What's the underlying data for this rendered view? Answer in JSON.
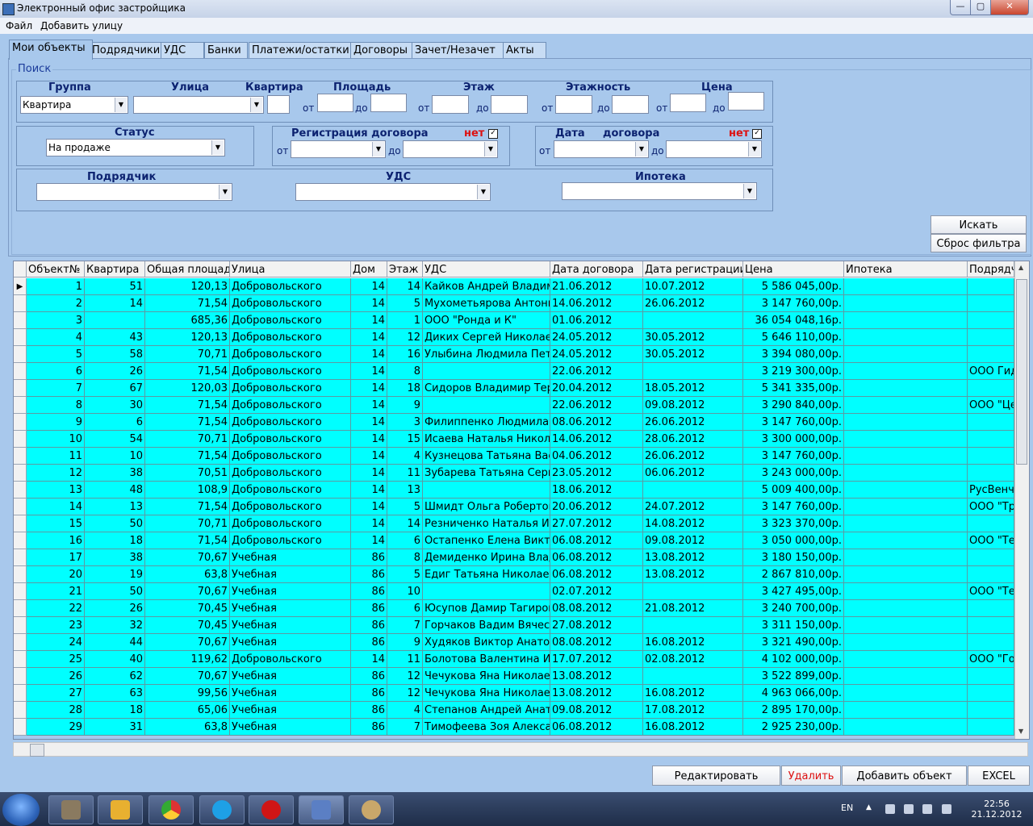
{
  "window": {
    "title": "Электронный офис застройщика",
    "min": "—",
    "max": "▢",
    "close": "✕"
  },
  "menu": [
    "Файл",
    "Добавить улицу"
  ],
  "tabs": [
    "Мои объекты",
    "Подрядчики",
    "УДС",
    "Банки",
    "Платежи/остатки",
    "Договоры",
    "Зачет/Незачет",
    "Акты"
  ],
  "search": {
    "legend": "Поиск",
    "group_label": "Группа",
    "group_value": "Квартира",
    "street_label": "Улица",
    "apartment_label": "Квартира",
    "area_label": "Площадь",
    "floor_label": "Этаж",
    "floors_label": "Этажность",
    "price_label": "Цена",
    "from": "от",
    "to": "до",
    "status_label": "Статус",
    "status_value": "На продаже",
    "reg_label": "Регистрация договора",
    "reg_none": "нет",
    "date_label": "Дата",
    "date_label2": "договора",
    "date_none": "нет",
    "contractor_label": "Подрядчик",
    "uds_label": "УДС",
    "mortgage_label": "Ипотека",
    "search_button": "Искать",
    "reset_button": "Сброс фильтра"
  },
  "grid": {
    "columns": [
      "Объект№",
      "Квартира",
      "Общая площадь",
      "Улица",
      "Дом",
      "Этаж",
      "УДС",
      "Дата договора",
      "Дата регистрации",
      "Цена",
      "Ипотека",
      "Подрядчик"
    ],
    "rows": [
      [
        "1",
        "51",
        "120,13",
        "Добровольского",
        "14",
        "14",
        "Кайков Андрей Владимирович",
        "21.06.2012",
        "10.07.2012",
        "5 586 045,00р.",
        "",
        ""
      ],
      [
        "2",
        "14",
        "71,54",
        "Добровольского",
        "14",
        "5",
        "Мухометьярова Антонина",
        "14.06.2012",
        "26.06.2012",
        "3 147 760,00р.",
        "",
        ""
      ],
      [
        "3",
        "",
        "685,36",
        "Добровольского",
        "14",
        "1",
        "ООО \"Ронда и К\"",
        "01.06.2012",
        "",
        "36 054 048,16р.",
        "",
        ""
      ],
      [
        "4",
        "43",
        "120,13",
        "Добровольского",
        "14",
        "12",
        "Диких Сергей Николаевич",
        "24.05.2012",
        "30.05.2012",
        "5 646 110,00р.",
        "",
        ""
      ],
      [
        "5",
        "58",
        "70,71",
        "Добровольского",
        "14",
        "16",
        "Улыбина Людмила Петровна",
        "24.05.2012",
        "30.05.2012",
        "3 394 080,00р.",
        "",
        ""
      ],
      [
        "6",
        "26",
        "71,54",
        "Добровольского",
        "14",
        "8",
        "",
        "22.06.2012",
        "",
        "3 219 300,00р.",
        "",
        "ООО Гидро"
      ],
      [
        "7",
        "67",
        "120,03",
        "Добровольского",
        "14",
        "18",
        "Сидоров Владимир Терентьевич",
        "20.04.2012",
        "18.05.2012",
        "5 341 335,00р.",
        "",
        ""
      ],
      [
        "8",
        "30",
        "71,54",
        "Добровольского",
        "14",
        "9",
        "",
        "22.06.2012",
        "09.08.2012",
        "3 290 840,00р.",
        "",
        "ООО \"Центр\""
      ],
      [
        "9",
        "6",
        "71,54",
        "Добровольского",
        "14",
        "3",
        "Филиппенко Людмила Е",
        "08.06.2012",
        "26.06.2012",
        "3 147 760,00р.",
        "",
        ""
      ],
      [
        "10",
        "54",
        "70,71",
        "Добровольского",
        "14",
        "15",
        "Исаева Наталья Николаевна",
        "14.06.2012",
        "28.06.2012",
        "3 300 000,00р.",
        "",
        ""
      ],
      [
        "11",
        "10",
        "71,54",
        "Добровольского",
        "14",
        "4",
        "Кузнецова Татьяна Васильевна",
        "04.06.2012",
        "26.06.2012",
        "3 147 760,00р.",
        "",
        ""
      ],
      [
        "12",
        "38",
        "70,51",
        "Добровольского",
        "14",
        "11",
        "Зубарева Татьяна Сергеевна",
        "23.05.2012",
        "06.06.2012",
        "3 243 000,00р.",
        "",
        ""
      ],
      [
        "13",
        "48",
        "108,9",
        "Добровольского",
        "14",
        "13",
        "",
        "18.06.2012",
        "",
        "5 009 400,00р.",
        "",
        "РусВенчур"
      ],
      [
        "14",
        "13",
        "71,54",
        "Добровольского",
        "14",
        "5",
        "Шмидт Ольга Робертовна",
        "20.06.2012",
        "24.07.2012",
        "3 147 760,00р.",
        "",
        "ООО \"Тр"
      ],
      [
        "15",
        "50",
        "70,71",
        "Добровольского",
        "14",
        "14",
        "Резниченко Наталья Ивановна",
        "27.07.2012",
        "14.08.2012",
        "3 323 370,00р.",
        "",
        ""
      ],
      [
        "16",
        "18",
        "71,54",
        "Добровольского",
        "14",
        "6",
        "Остапенко Елена Викторовна",
        "06.08.2012",
        "09.08.2012",
        "3 050 000,00р.",
        "",
        "ООО \"Те"
      ],
      [
        "17",
        "38",
        "70,67",
        "Учебная",
        "86",
        "8",
        "Демиденко Ирина Владимировна",
        "06.08.2012",
        "13.08.2012",
        "3 180 150,00р.",
        "",
        ""
      ],
      [
        "20",
        "19",
        "63,8",
        "Учебная",
        "86",
        "5",
        "Едиг Татьяна Николаевна",
        "06.08.2012",
        "13.08.2012",
        "2 867 810,00р.",
        "",
        ""
      ],
      [
        "21",
        "50",
        "70,67",
        "Учебная",
        "86",
        "10",
        "",
        "02.07.2012",
        "",
        "3 427 495,00р.",
        "",
        "ООО \"Те"
      ],
      [
        "22",
        "26",
        "70,45",
        "Учебная",
        "86",
        "6",
        "Юсупов Дамир Тагирович",
        "08.08.2012",
        "21.08.2012",
        "3 240 700,00р.",
        "",
        ""
      ],
      [
        "23",
        "32",
        "70,45",
        "Учебная",
        "86",
        "7",
        "Горчаков Вадим Вячеславович",
        "27.08.2012",
        "",
        "3 311 150,00р.",
        "",
        ""
      ],
      [
        "24",
        "44",
        "70,67",
        "Учебная",
        "86",
        "9",
        "Худяков Виктор Анатольевич",
        "08.08.2012",
        "16.08.2012",
        "3 321 490,00р.",
        "",
        ""
      ],
      [
        "25",
        "40",
        "119,62",
        "Добровольского",
        "14",
        "11",
        "Болотова Валентина И",
        "17.07.2012",
        "02.08.2012",
        "4 102 000,00р.",
        "",
        "ООО \"Го"
      ],
      [
        "26",
        "62",
        "70,67",
        "Учебная",
        "86",
        "12",
        "Чечукова Яна Николаевна",
        "13.08.2012",
        "",
        "3 522 899,00р.",
        "",
        ""
      ],
      [
        "27",
        "63",
        "99,56",
        "Учебная",
        "86",
        "12",
        "Чечукова Яна Николаевна",
        "13.08.2012",
        "16.08.2012",
        "4 963 066,00р.",
        "",
        ""
      ],
      [
        "28",
        "18",
        "65,06",
        "Учебная",
        "86",
        "4",
        "Степанов Андрей Анатольевич",
        "09.08.2012",
        "17.08.2012",
        "2 895 170,00р.",
        "",
        ""
      ],
      [
        "29",
        "31",
        "63,8",
        "Учебная",
        "86",
        "7",
        "Тимофеева Зоя Александровна",
        "06.08.2012",
        "16.08.2012",
        "2 925 230,00р.",
        "",
        ""
      ]
    ]
  },
  "actions": {
    "edit": "Редактировать",
    "delete": "Удалить",
    "add": "Добавить объект",
    "excel": "EXCEL"
  },
  "taskbar": {
    "lang": "EN",
    "time": "22:56",
    "date": "21.12.2012"
  },
  "colors": {
    "row_bg": "#00ffff",
    "panel_bg": "#a8c8ec",
    "header_text": "#0c2270",
    "alert": "#dd1111"
  }
}
